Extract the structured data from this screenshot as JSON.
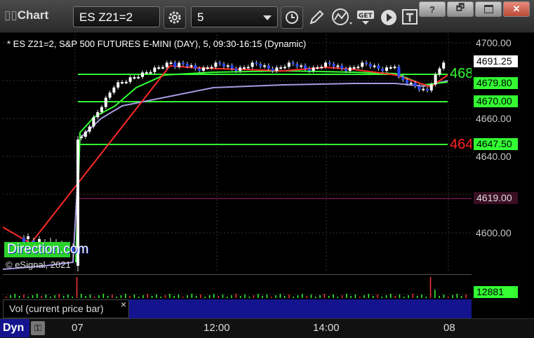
{
  "toolbar": {
    "app_title": "Chart",
    "symbol": "ES Z21=2",
    "interval": "5"
  },
  "window_controls": [
    "?",
    "",
    "",
    ""
  ],
  "chart": {
    "header": "* ES Z21=2, S&P 500 FUTURES E-MINI (DAY), 5, 09:30-16:15 (Dynamic)",
    "watermark": "Direction.com",
    "copyright": "© eSignal, 2021",
    "line_label_1": "468",
    "line_label_2": "464"
  },
  "price_axis": {
    "ticks": [
      "4700.00",
      "4680.00",
      "4660.00",
      "4640.00",
      "4600.00"
    ],
    "last_price": "4691.25",
    "level_1": "4679.80",
    "level_2": "4670.00",
    "level_3": "4647.50",
    "level_4": "4619.00"
  },
  "volume": {
    "label": "Vol (current price bar)",
    "value": "12881",
    "close": "×"
  },
  "time_axis": {
    "mode": "Dyn",
    "ticks": [
      "07",
      "12:00",
      "14:00",
      "08"
    ]
  },
  "colors": {
    "up": "#ffffff",
    "down": "#2a4bff",
    "level_green": "#33ff33",
    "level_red": "#ff2222",
    "ma_purple": "#a79ae0",
    "accent_blue": "#14148f"
  }
}
